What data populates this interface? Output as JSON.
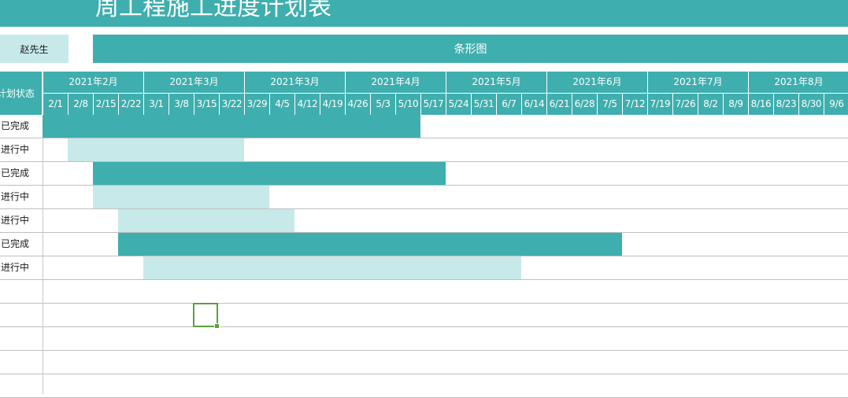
{
  "header": {
    "title": "周工程施工进度计划表",
    "owner": "赵先生",
    "chart_label": "条形图"
  },
  "timeline": {
    "status_header": "计划状态",
    "months": [
      {
        "label": "2021年2月",
        "weeks": 4
      },
      {
        "label": "2021年3月",
        "weeks": 4
      },
      {
        "label": "2021年3月",
        "weeks": 4
      },
      {
        "label": "2021年4月",
        "weeks": 4
      },
      {
        "label": "2021年5月",
        "weeks": 4
      },
      {
        "label": "2021年6月",
        "weeks": 4
      },
      {
        "label": "2021年7月",
        "weeks": 4
      },
      {
        "label": "2021年8月",
        "weeks": 4
      }
    ],
    "weeks": [
      "2/1",
      "2/8",
      "2/15",
      "2/22",
      "3/1",
      "3/8",
      "3/15",
      "3/22",
      "3/29",
      "4/5",
      "4/12",
      "4/19",
      "4/26",
      "5/3",
      "5/10",
      "5/17",
      "5/24",
      "5/31",
      "6/7",
      "6/14",
      "6/21",
      "6/28",
      "7/5",
      "7/12",
      "7/19",
      "7/26",
      "8/2",
      "8/9",
      "8/16",
      "8/23",
      "8/30",
      "9/6"
    ]
  },
  "tasks": [
    {
      "status": "已完成",
      "start_week": "2/1",
      "end_week": "5/17",
      "state": "done"
    },
    {
      "status": "进行中",
      "start_week": "2/8",
      "end_week": "3/29",
      "state": "doing"
    },
    {
      "status": "已完成",
      "start_week": "2/15",
      "end_week": "5/24",
      "state": "done"
    },
    {
      "status": "进行中",
      "start_week": "2/15",
      "end_week": "4/5",
      "state": "doing"
    },
    {
      "status": "进行中",
      "start_week": "2/22",
      "end_week": "4/12",
      "state": "doing"
    },
    {
      "status": "已完成",
      "start_week": "2/22",
      "end_week": "7/12",
      "state": "done"
    },
    {
      "status": "进行中",
      "start_week": "3/1",
      "end_week": "6/14",
      "state": "doing"
    }
  ],
  "colors": {
    "accent": "#3eaeae",
    "accent_light": "#c7e9e9",
    "selection": "#5a9f3a"
  }
}
